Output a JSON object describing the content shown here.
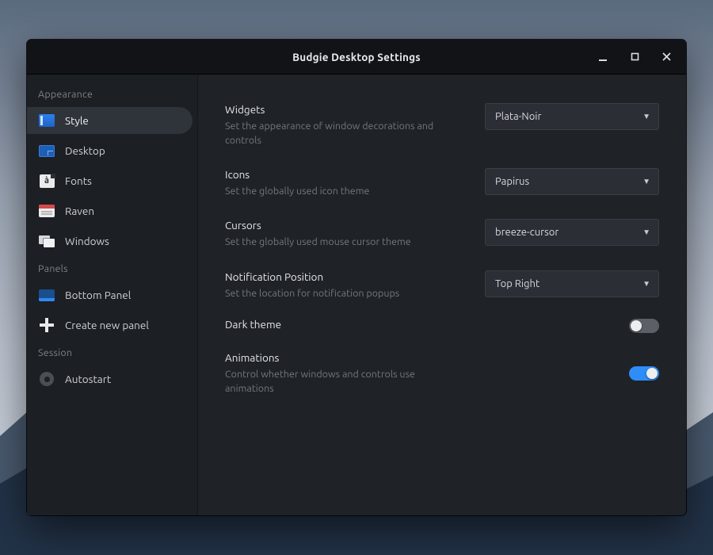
{
  "window": {
    "title": "Budgie Desktop Settings"
  },
  "sidebar": {
    "sections": [
      {
        "label": "Appearance",
        "items": [
          {
            "id": "style",
            "label": "Style",
            "icon": "style-icon",
            "active": true
          },
          {
            "id": "desktop",
            "label": "Desktop",
            "icon": "desktop-icon",
            "active": false
          },
          {
            "id": "fonts",
            "label": "Fonts",
            "icon": "fonts-icon",
            "active": false
          },
          {
            "id": "raven",
            "label": "Raven",
            "icon": "raven-icon",
            "active": false
          },
          {
            "id": "windows",
            "label": "Windows",
            "icon": "windows-icon",
            "active": false
          }
        ]
      },
      {
        "label": "Panels",
        "items": [
          {
            "id": "bottom-panel",
            "label": "Bottom Panel",
            "icon": "panel-icon",
            "active": false
          },
          {
            "id": "new-panel",
            "label": "Create new panel",
            "icon": "plus-icon",
            "active": false
          }
        ]
      },
      {
        "label": "Session",
        "items": [
          {
            "id": "autostart",
            "label": "Autostart",
            "icon": "gear-icon",
            "active": false
          }
        ]
      }
    ]
  },
  "settings": {
    "widgets": {
      "label": "Widgets",
      "desc": "Set the appearance of window decorations and controls",
      "value": "Plata-Noir"
    },
    "icons": {
      "label": "Icons",
      "desc": "Set the globally used icon theme",
      "value": "Papirus"
    },
    "cursors": {
      "label": "Cursors",
      "desc": "Set the globally used mouse cursor theme",
      "value": "breeze-cursor"
    },
    "notification_position": {
      "label": "Notification Position",
      "desc": "Set the location for notification popups",
      "value": "Top Right"
    },
    "dark_theme": {
      "label": "Dark theme",
      "value": false
    },
    "animations": {
      "label": "Animations",
      "desc": "Control whether windows and controls use animations",
      "value": true
    }
  }
}
